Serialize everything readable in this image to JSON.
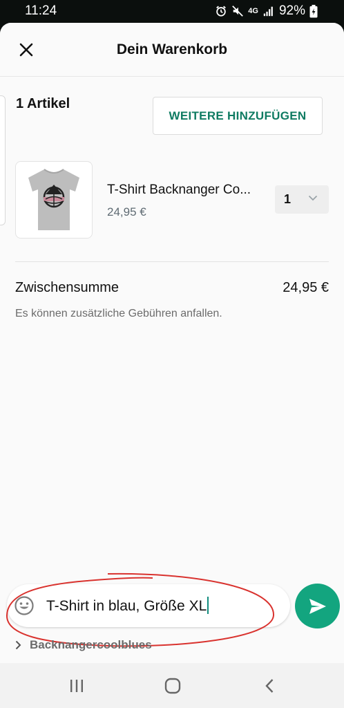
{
  "status_bar": {
    "time": "11:24",
    "network": "4G",
    "battery": "92%",
    "icons": [
      "alarm-icon",
      "mute-icon",
      "network-4g-icon",
      "signal-icon",
      "battery-icon"
    ]
  },
  "header": {
    "title": "Dein Warenkorb",
    "close_icon": "close-icon"
  },
  "cart": {
    "item_count_label": "1 Artikel",
    "add_more_label": "WEITERE HINZUFÜGEN",
    "items": [
      {
        "name": "T-Shirt Backnanger Co...",
        "price": "24,95 €",
        "quantity": "1",
        "image_icon": "tshirt-image"
      }
    ],
    "subtotal_label": "Zwischensumme",
    "subtotal_value": "24,95 €",
    "fees_note": "Es können zusätzliche Gebühren anfallen."
  },
  "composer": {
    "message": "T-Shirt in blau, Größe XL",
    "emoji_icon": "emoji-icon",
    "send_icon": "send-icon"
  },
  "business": {
    "name": "Backnangercoolblues"
  },
  "nav": {
    "items": [
      "recent-apps-icon",
      "home-icon",
      "back-icon"
    ]
  },
  "colors": {
    "accent": "#0f7b62",
    "send_button": "#13a57f",
    "annotation": "#d9322e"
  }
}
